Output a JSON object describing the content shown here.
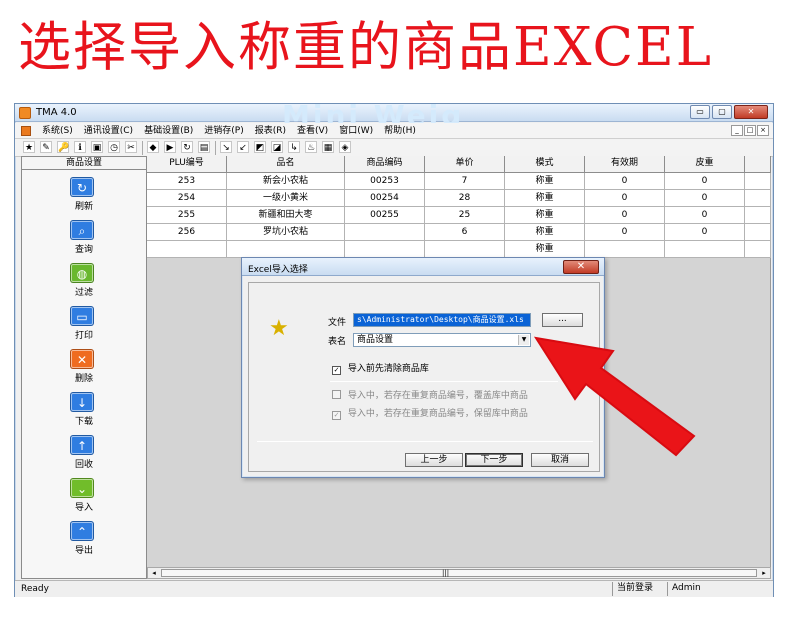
{
  "headline": "选择导入称重的商品EXCEL",
  "watermark": "Mini Weig",
  "window": {
    "title": "TMA 4.0",
    "controls": [
      "▭",
      "▢",
      "✕"
    ],
    "mdi_controls": [
      "_",
      "□",
      "×"
    ]
  },
  "menu": {
    "items": [
      "系统(S)",
      "通讯设置(C)",
      "基础设置(B)",
      "进销存(P)",
      "报表(R)",
      "查看(V)",
      "窗口(W)",
      "帮助(H)"
    ]
  },
  "toolbar": {
    "icons": [
      "★",
      "✎",
      "🔑",
      "ℹ",
      "▣",
      "◷",
      "✂",
      "◆",
      "▶",
      "↻",
      "▤",
      "↘",
      "↙",
      "◩",
      "◪",
      "↳",
      "♨",
      "▦",
      "◈"
    ]
  },
  "sidebar": {
    "header": "商品设置",
    "items": [
      {
        "label": "刷新",
        "icon": "↻",
        "color": "#2f7de1"
      },
      {
        "label": "查询",
        "icon": "⌕",
        "color": "#2f7de1"
      },
      {
        "label": "过滤",
        "icon": "◍",
        "color": "#69b82e"
      },
      {
        "label": "打印",
        "icon": "▭",
        "color": "#2f7de1"
      },
      {
        "label": "删除",
        "icon": "✕",
        "color": "#ef6c20"
      },
      {
        "label": "下载",
        "icon": "↓",
        "color": "#2f7de1"
      },
      {
        "label": "回收",
        "icon": "↑",
        "color": "#2f7de1"
      },
      {
        "label": "导入",
        "icon": "⌄",
        "color": "#71bd2a"
      },
      {
        "label": "导出",
        "icon": "⌃",
        "color": "#2f7de1"
      }
    ]
  },
  "table": {
    "headers": [
      "PLU编号",
      "品名",
      "商品编码",
      "单价",
      "模式",
      "有效期",
      "皮重",
      ""
    ],
    "rows": [
      [
        "253",
        "新会小农粘",
        "00253",
        "7",
        "称重",
        "0",
        "0",
        ""
      ],
      [
        "254",
        "一级小黄米",
        "00254",
        "28",
        "称重",
        "0",
        "0",
        ""
      ],
      [
        "255",
        "新疆和田大枣",
        "00255",
        "25",
        "称重",
        "0",
        "0",
        ""
      ],
      [
        "256",
        "罗坑小农粘",
        "",
        "6",
        "称重",
        "0",
        "0",
        ""
      ],
      [
        "",
        "",
        "",
        "",
        "称重",
        "",
        "",
        ""
      ]
    ]
  },
  "scrollbar": {
    "left_arrow": "◂",
    "right_arrow": "▸",
    "grip": "|||"
  },
  "status": {
    "ready": "Ready",
    "login_label": "当前登录",
    "user": "Admin"
  },
  "dialog": {
    "title": "Excel导入选择",
    "close": "✕",
    "file_label": "文件",
    "file_value": "s\\Administrator\\Desktop\\商品设置.xls",
    "browse_label": "...",
    "sheet_label": "表名",
    "sheet_value": "商品设置",
    "dropdown_arrow": "▼",
    "clear_before_import": "导入前先清除商品库",
    "checkbox_mark": "✓",
    "option_overwrite": "导入中，若存在重复商品编号，覆盖库中商品",
    "option_keep": "导入中，若存在重复商品编号，保留库中商品",
    "buttons": {
      "prev": "上一步",
      "next": "下一步",
      "cancel": "取消"
    }
  },
  "colors": {
    "headline": "#e8141c",
    "arrow": "#ea1418",
    "window_border": "#6f8fb5"
  }
}
